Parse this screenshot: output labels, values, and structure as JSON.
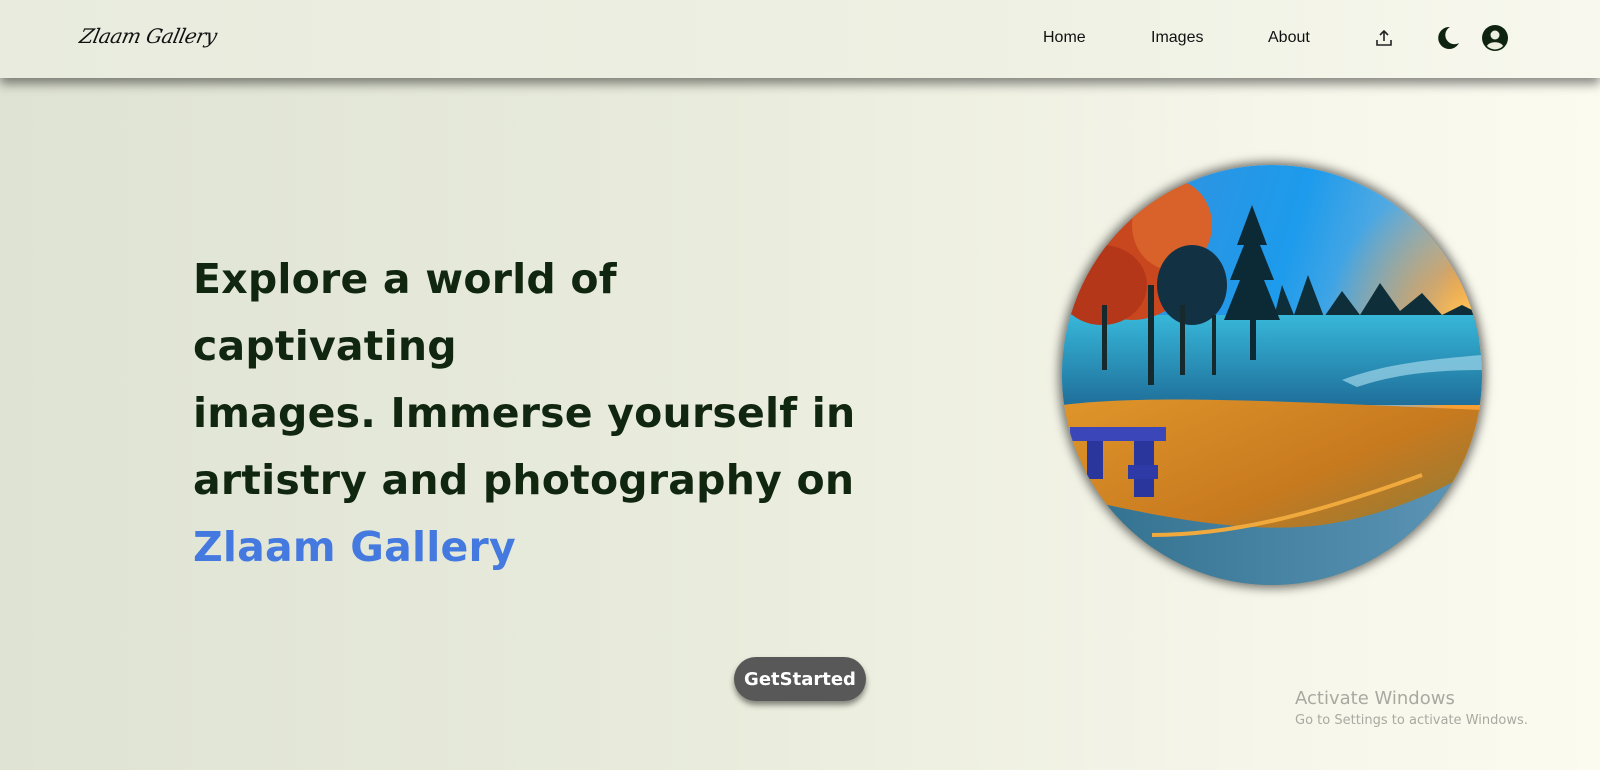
{
  "brand": {
    "name": "Zlaam Gallery"
  },
  "nav": {
    "links": [
      {
        "label": "Home"
      },
      {
        "label": "Images"
      },
      {
        "label": "About"
      }
    ],
    "icons": [
      "upload-icon",
      "moon-icon",
      "user-icon"
    ]
  },
  "hero": {
    "headline_lines": [
      "Explore a world of captivating",
      "images. Immerse yourself in",
      "artistry and photography on"
    ],
    "highlight": "Zlaam Gallery",
    "cta_label": "GetStarted",
    "image_alt": "Autumn park landscape with trees, blue sky and bench"
  },
  "watermark": {
    "title": "Activate Windows",
    "subtitle": "Go to Settings to activate Windows."
  },
  "colors": {
    "accent": "#4479e0",
    "heading": "#10260f",
    "button": "#585858",
    "background": "#e9ecdc"
  }
}
